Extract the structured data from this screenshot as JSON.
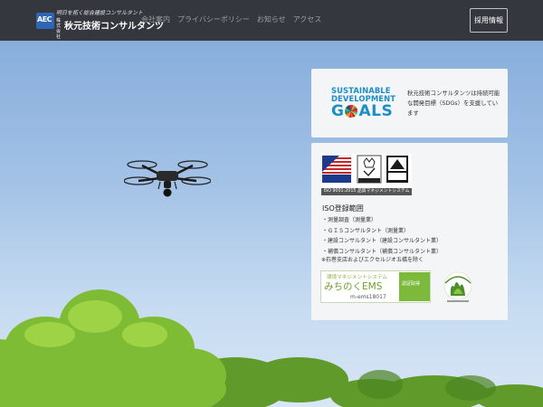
{
  "header": {
    "logo": {
      "mark": "AEC",
      "tagline": "明日を拓く総合建設コンサルタント",
      "prefix": "株式会社",
      "name": "秋元技術コンサルタンツ"
    },
    "nav": [
      {
        "label": "会社案内"
      },
      {
        "label": "プライバシーポリシー"
      },
      {
        "label": "お知らせ"
      },
      {
        "label": "アクセス"
      }
    ],
    "recruit_button": "採用情報"
  },
  "sdgs": {
    "logo_line1": "SUSTAINABLE",
    "logo_line2": "DEVELOPMENT",
    "logo_go": "G",
    "logo_als": "ALS",
    "text": "秋元技術コンサルタンツは持続可能な開発目標（SDGs）を支援しています"
  },
  "iso": {
    "cert_caption": "ISO 9001:2015 品質マネジメントシステム",
    "cert_labels": {
      "perry": "PERRY JOHNSON REGISTRARS, INC.",
      "ukas": "UKAS",
      "jab": "JAB"
    },
    "heading": "ISO登録範囲",
    "items": [
      "・測量調査（測量業）",
      "・ＧＩＳコンサルタント（測量業）",
      "・建設コンサルタント（建設コンサルタント業）",
      "・補償コンサルタント（補償コンサルタント業）"
    ],
    "note": "※石巻支店およびエクセルジオ五橋を除く"
  },
  "ems": {
    "small": "環境マネジメントシステム",
    "big": "みちのくEMS",
    "code": "m-ems18017",
    "badge": "認証取得"
  },
  "colors": {
    "navbar": "#34373d",
    "sdg_blue": "#1b8ec8",
    "ems_green": "#6e9f2a"
  }
}
